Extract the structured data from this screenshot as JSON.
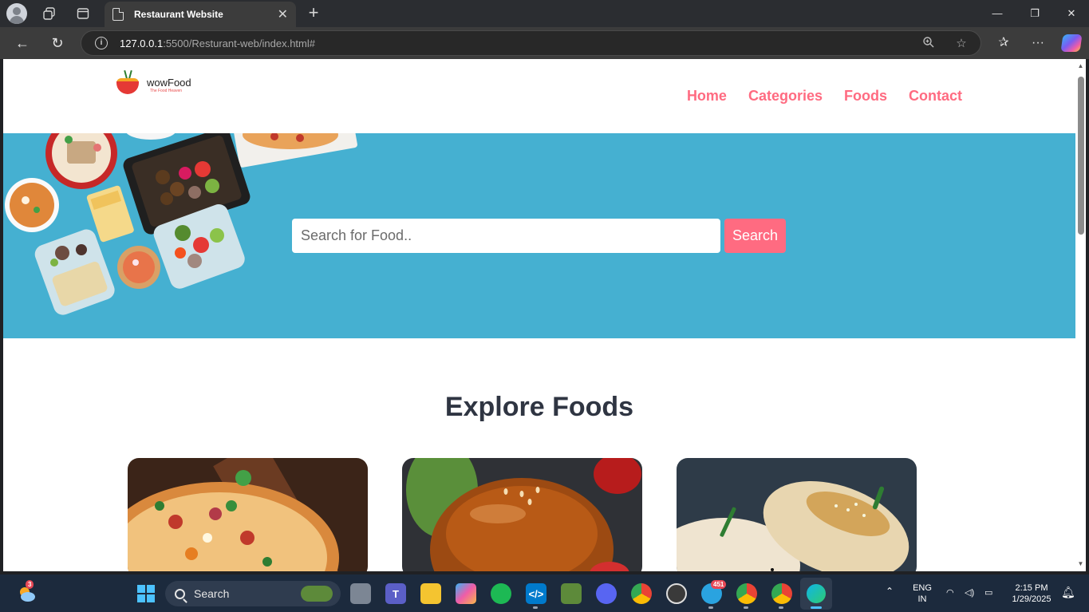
{
  "browser": {
    "tab_title": "Restaurant Website",
    "tab_close": "✕",
    "new_tab": "+",
    "url_host": "127.0.0.1",
    "url_path": ":5500/Resturant-web/index.html#",
    "window_controls": [
      "—",
      "❐",
      "✕"
    ]
  },
  "site": {
    "brand_name": "wowFood",
    "brand_tagline": "The Food Heaven",
    "nav": [
      "Home",
      "Categories",
      "Foods",
      "Contact"
    ],
    "search_placeholder": "Search for Food..",
    "search_button": "Search",
    "section_title": "Explore Foods",
    "cards": [
      {
        "name": "pizza-image",
        "icon": "pizza"
      },
      {
        "name": "burger-image",
        "icon": "burger"
      },
      {
        "name": "momo-image",
        "icon": "dumpling"
      }
    ],
    "colors": {
      "accent": "#ff6b81",
      "hero": "#45b0d1",
      "heading": "#2f3542"
    }
  },
  "taskbar": {
    "search_label": "Search",
    "weather_badge": "3",
    "telegram_badge": "451",
    "language_top": "ENG",
    "language_bottom": "IN",
    "time": "2:15 PM",
    "date": "1/29/2025"
  }
}
